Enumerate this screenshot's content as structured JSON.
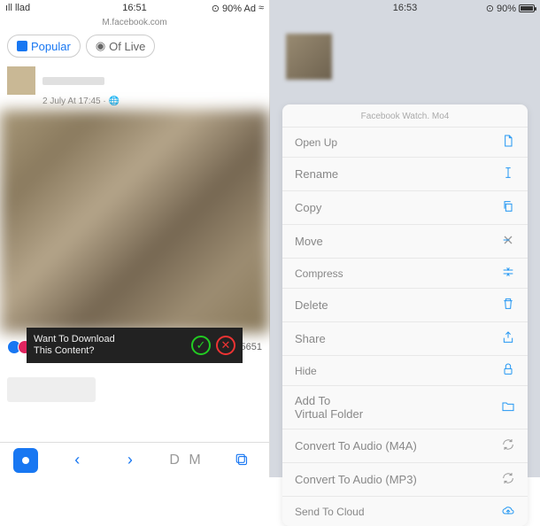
{
  "left": {
    "status": {
      "carrier": "ıll llad",
      "wifi": "≈",
      "time": "16:51",
      "battery_text": "⊙ 90% Ad",
      "battery_icon": "≈"
    },
    "url": "M.facebook.com",
    "tabs": {
      "popular": "Popular",
      "live": "Of Live"
    },
    "post": {
      "meta": "2 July At 17:45 · 🌐",
      "reactions_count": "55651"
    },
    "download": {
      "line1": "Want To Download",
      "line2": "This Content?"
    },
    "bottombar": {
      "dm": "D M"
    }
  },
  "right": {
    "status": {
      "time": "16:53",
      "battery": "⊙ 90%"
    },
    "menu_title": "Facebook Watch. Mo4",
    "items": [
      {
        "label": "Open Up",
        "icon": "doc",
        "compact": true
      },
      {
        "label": "Rename",
        "icon": "rename"
      },
      {
        "label": "Copy",
        "icon": "copy"
      },
      {
        "label": "Move",
        "icon": "move"
      },
      {
        "label": "Compress",
        "icon": "compress",
        "compact": true
      },
      {
        "label": "Delete",
        "icon": "trash"
      },
      {
        "label": "Share",
        "icon": "share"
      },
      {
        "label": "Hide",
        "icon": "lock",
        "compact": true
      },
      {
        "label": "Add To\nVirtual Folder",
        "icon": "folder"
      },
      {
        "label": "Convert To Audio (M4A)",
        "icon": "cycle",
        "gray": true
      },
      {
        "label": "Convert To Audio (MP3)",
        "icon": "cycle",
        "gray": true
      },
      {
        "label": "Send To Cloud",
        "icon": "cloud",
        "compact": true
      }
    ]
  }
}
